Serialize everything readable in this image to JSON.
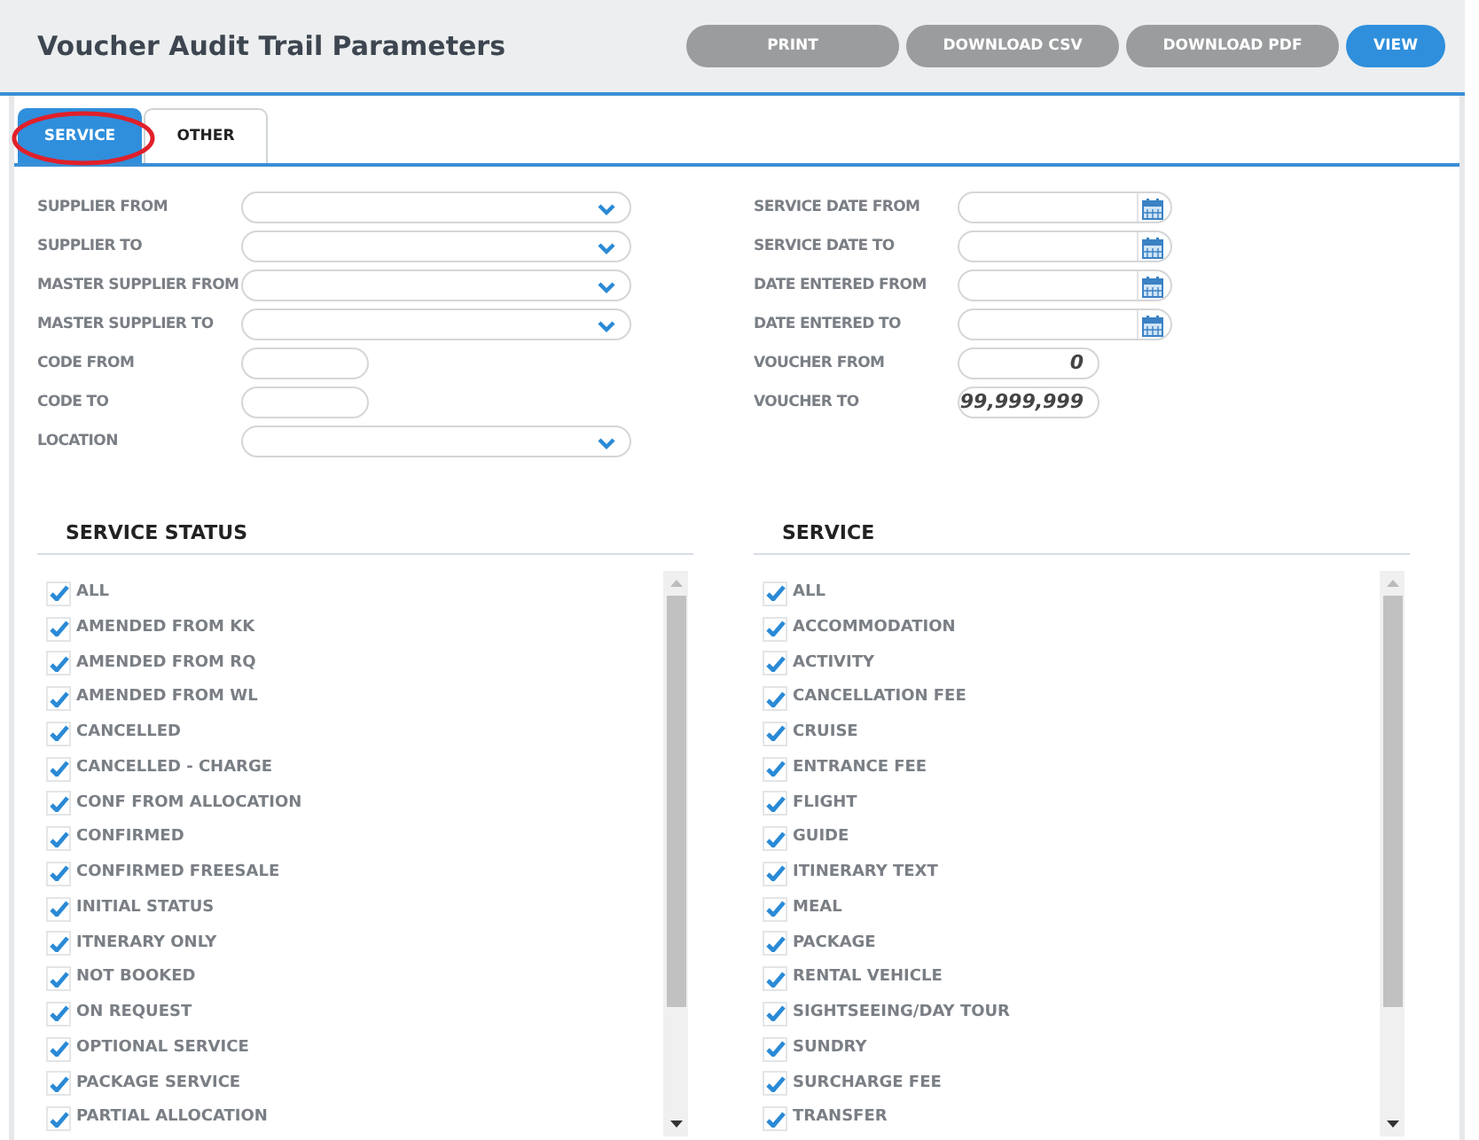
{
  "title": "Voucher Audit Trail Parameters",
  "buttons": [
    {
      "label": "PRINT",
      "kind": "secondary"
    },
    {
      "label": "DOWNLOAD CSV",
      "kind": "secondary"
    },
    {
      "label": "DOWNLOAD PDF",
      "kind": "secondary"
    },
    {
      "label": "VIEW",
      "kind": "primary"
    }
  ],
  "tabs": [
    {
      "label": "SERVICE",
      "selected": true
    },
    {
      "label": "OTHER",
      "selected": false
    }
  ],
  "left_fields": [
    {
      "label": "SUPPLIER FROM",
      "kind": "select"
    },
    {
      "label": "SUPPLIER TO",
      "kind": "select"
    },
    {
      "label": "MASTER SUPPLIER FROM",
      "kind": "select"
    },
    {
      "label": "MASTER SUPPLIER TO",
      "kind": "select"
    },
    {
      "label": "CODE FROM",
      "kind": "text"
    },
    {
      "label": "CODE TO",
      "kind": "text"
    },
    {
      "label": "LOCATION",
      "kind": "select"
    }
  ],
  "right_fields": [
    {
      "label": "SERVICE DATE FROM",
      "kind": "date"
    },
    {
      "label": "SERVICE DATE TO",
      "kind": "date"
    },
    {
      "label": "DATE ENTERED FROM",
      "kind": "date"
    },
    {
      "label": "DATE ENTERED TO",
      "kind": "date"
    },
    {
      "label": "VOUCHER FROM",
      "kind": "number",
      "value": "0"
    },
    {
      "label": "VOUCHER TO",
      "kind": "number",
      "value": "99,999,999"
    }
  ],
  "lists": [
    {
      "title": "SERVICE STATUS",
      "items": [
        {
          "label": "ALL",
          "checked": true
        },
        {
          "label": "AMENDED FROM KK",
          "checked": true
        },
        {
          "label": "AMENDED FROM RQ",
          "checked": true
        },
        {
          "label": "AMENDED FROM WL",
          "checked": true
        },
        {
          "label": "CANCELLED",
          "checked": true
        },
        {
          "label": "CANCELLED - CHARGE",
          "checked": true
        },
        {
          "label": "CONF FROM ALLOCATION",
          "checked": true
        },
        {
          "label": "CONFIRMED",
          "checked": true
        },
        {
          "label": "CONFIRMED FREESALE",
          "checked": true
        },
        {
          "label": "INITIAL STATUS",
          "checked": true
        },
        {
          "label": "ITNERARY ONLY",
          "checked": true
        },
        {
          "label": "NOT BOOKED",
          "checked": true
        },
        {
          "label": "ON REQUEST",
          "checked": true
        },
        {
          "label": "OPTIONAL SERVICE",
          "checked": true
        },
        {
          "label": "PACKAGE SERVICE",
          "checked": true
        },
        {
          "label": "PARTIAL ALLOCATION",
          "checked": true
        }
      ]
    },
    {
      "title": "SERVICE",
      "items": [
        {
          "label": "ALL",
          "checked": true
        },
        {
          "label": "ACCOMMODATION",
          "checked": true
        },
        {
          "label": "ACTIVITY",
          "checked": true
        },
        {
          "label": "CANCELLATION FEE",
          "checked": true
        },
        {
          "label": "CRUISE",
          "checked": true
        },
        {
          "label": "ENTRANCE FEE",
          "checked": true
        },
        {
          "label": "FLIGHT",
          "checked": true
        },
        {
          "label": "GUIDE",
          "checked": true
        },
        {
          "label": "ITINERARY TEXT",
          "checked": true
        },
        {
          "label": "MEAL",
          "checked": true
        },
        {
          "label": "PACKAGE",
          "checked": true
        },
        {
          "label": "RENTAL VEHICLE",
          "checked": true
        },
        {
          "label": "SIGHTSEEING/DAY TOUR",
          "checked": true
        },
        {
          "label": "SUNDRY",
          "checked": true
        },
        {
          "label": "SURCHARGE FEE",
          "checked": true
        },
        {
          "label": "TRANSFER",
          "checked": true
        }
      ]
    }
  ]
}
